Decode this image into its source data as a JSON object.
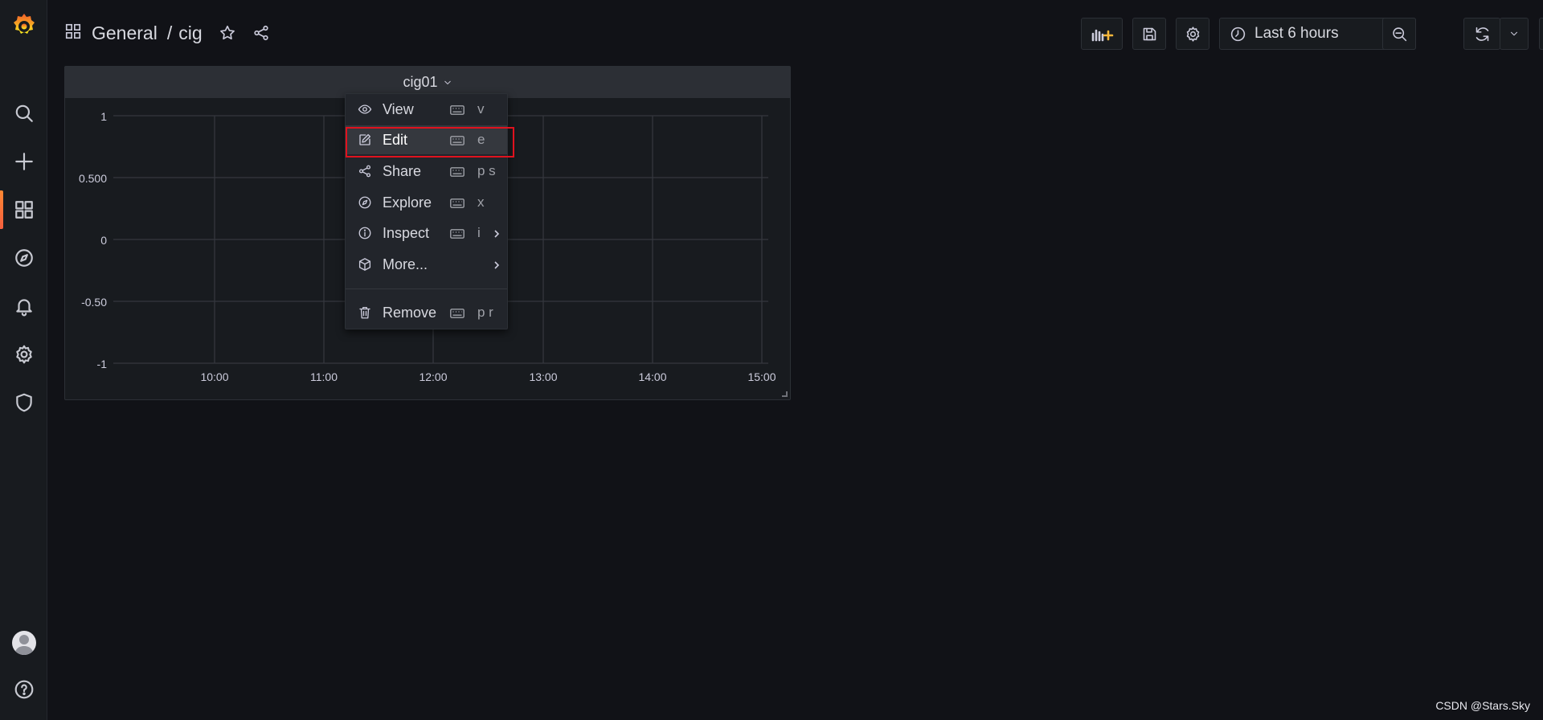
{
  "header": {
    "breadcrumb": [
      "General",
      "cig"
    ],
    "separator": "/",
    "time_range": "Last 6 hours"
  },
  "sidebar": {
    "items": [
      {
        "name": "search",
        "icon": "search-icon"
      },
      {
        "name": "create",
        "icon": "plus-icon"
      },
      {
        "name": "dashboards",
        "icon": "apps-icon",
        "active": true
      },
      {
        "name": "explore",
        "icon": "compass-icon"
      },
      {
        "name": "alerting",
        "icon": "bell-icon"
      },
      {
        "name": "configuration",
        "icon": "gear-icon"
      },
      {
        "name": "server-admin",
        "icon": "shield-icon"
      },
      {
        "name": "profile",
        "icon": "avatar"
      },
      {
        "name": "help",
        "icon": "question-icon"
      }
    ]
  },
  "panel": {
    "title": "cig01"
  },
  "chart_data": {
    "type": "line",
    "title": "cig01",
    "x": [
      "10:00",
      "11:00",
      "12:00",
      "13:00",
      "14:00",
      "15:00"
    ],
    "yticks": [
      "1",
      "0.500",
      "0",
      "-0.50",
      "-1"
    ],
    "ylim": [
      -1,
      1
    ],
    "series": [],
    "grid": true
  },
  "menu": {
    "items": [
      {
        "label": "View",
        "shortcut": "v",
        "icon": "eye-icon"
      },
      {
        "label": "Edit",
        "shortcut": "e",
        "icon": "edit-icon",
        "highlighted": true
      },
      {
        "label": "Share",
        "shortcut": "p s",
        "icon": "share-icon"
      },
      {
        "label": "Explore",
        "shortcut": "x",
        "icon": "compass-icon"
      },
      {
        "label": "Inspect",
        "shortcut": "i",
        "icon": "info-icon",
        "submenu": true
      },
      {
        "label": "More...",
        "shortcut": "",
        "icon": "cube-icon",
        "submenu": true
      },
      {
        "label": "Remove",
        "shortcut": "p r",
        "icon": "trash-icon"
      }
    ]
  },
  "watermark": "CSDN @Stars.Sky",
  "colors": {
    "background": "#111217",
    "sidebar": "#181b1f",
    "panel_header": "#2c2f35",
    "accent": "#f55f3e",
    "highlight_box": "#e0121e"
  }
}
